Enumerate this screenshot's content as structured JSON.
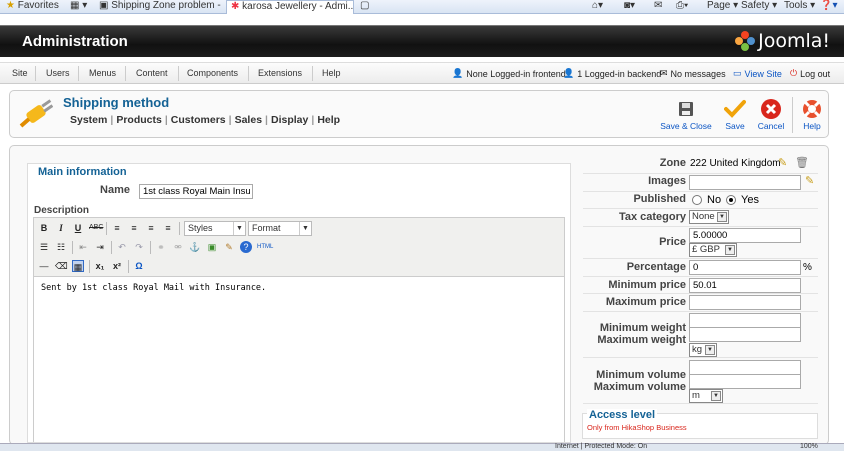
{
  "browser": {
    "favorites": "Favorites",
    "tab1": "Shipping Zone problem - ...",
    "tab2": "karosa Jewellery - Admi...",
    "page_menu": "Page",
    "safety_menu": "Safety",
    "tools_menu": "Tools",
    "status_text": "Internet | Protected Mode: On",
    "zoom": "100%"
  },
  "header": {
    "title": "Administration",
    "logo_text": "Joomla!"
  },
  "menubar": {
    "items": [
      "Site",
      "Users",
      "Menus",
      "Content",
      "Components",
      "Extensions",
      "Help"
    ],
    "status": {
      "frontend": "None Logged-in frontend",
      "backend": "1 Logged-in backend",
      "messages": "No messages",
      "view_site": "View Site",
      "logout": "Log out"
    }
  },
  "toolbar": {
    "page_title": "Shipping method",
    "submenu": [
      "System",
      "Products",
      "Customers",
      "Sales",
      "Display",
      "Help"
    ],
    "buttons": {
      "save_close": "Save & Close",
      "save": "Save",
      "cancel": "Cancel",
      "help": "Help"
    }
  },
  "main": {
    "legend": "Main information",
    "name_label": "Name",
    "name_value": "1st class Royal Main Insu",
    "description_label": "Description",
    "editor": {
      "styles": "Styles",
      "format": "Format",
      "content": "Sent by 1st class Royal Mail with Insurance."
    }
  },
  "right": {
    "zone_label": "Zone",
    "zone_value": "222 United Kingdom",
    "images_label": "Images",
    "published_label": "Published",
    "published_no": "No",
    "published_yes": "Yes",
    "published_value": "Yes",
    "tax_label": "Tax category",
    "tax_value": "None",
    "price_label": "Price",
    "price_value": "5.00000",
    "currency_value": "£ GBP",
    "percentage_label": "Percentage",
    "percentage_value": "0",
    "percent_sign": "%",
    "min_price_label": "Minimum price",
    "min_price_value": "50.01",
    "max_price_label": "Maximum price",
    "min_weight_label": "Minimum weight",
    "max_weight_label": "Maximum weight",
    "weight_unit": "kg",
    "min_volume_label": "Minimum volume",
    "max_volume_label": "Maximum volume",
    "volume_unit": "m",
    "access_legend": "Access level",
    "access_note": "Only from HikaShop Business"
  },
  "colors": {
    "title_blue": "#146295",
    "header_black": "#111111",
    "link_blue": "#0b55c4",
    "cancel_red": "#d9261c",
    "save_orange": "#f0a30a"
  }
}
